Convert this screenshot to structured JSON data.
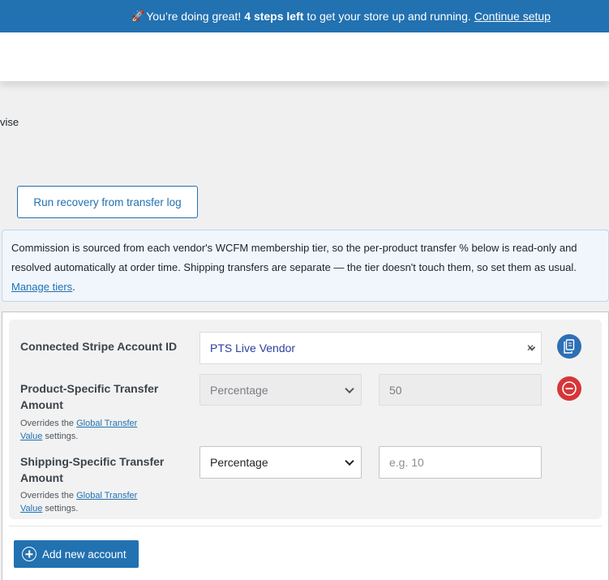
{
  "banner": {
    "lead": "You’re doing great!",
    "strong": "4 steps left",
    "rest": "to get your store up and running.",
    "link": "Continue setup",
    "rocket_icon": "rocket-emoji"
  },
  "page": {
    "cut_text": "vise",
    "recovery_button": "Run recovery from transfer log"
  },
  "notice": {
    "text": "Commission is sourced from each vendor's WCFM membership tier, so the per-product transfer % below is read-only and resolved automatically at order time. Shipping transfers are separate — the tier doesn't touch them, so set them as usual.",
    "link": "Manage tiers",
    "tail": "."
  },
  "account": {
    "connected_label": "Connected Stripe Account ID",
    "connected_value": "PTS Live Vendor",
    "product_label_1": "Product-Specific Transfer",
    "product_label_2": "Amount",
    "product_overrides_prefix": "Overrides the",
    "product_link_1": "Global Transfer",
    "product_link_2": "Value",
    "product_overrides_suffix": "settings.",
    "product_type": "Percentage",
    "product_value": "50",
    "shipping_label_1": "Shipping-Specific Transfer",
    "shipping_label_2": "Amount",
    "shipping_overrides_prefix": "Overrides the",
    "shipping_link_1": "Global Transfer",
    "shipping_link_2": "Value",
    "shipping_overrides_suffix": "settings.",
    "shipping_type": "Percentage",
    "shipping_placeholder": "e.g. 10"
  },
  "actions": {
    "add_account": "Add new account"
  },
  "colors": {
    "primary": "#2271b1",
    "danger": "#d63638",
    "notice_bg": "#f0f6fc"
  }
}
